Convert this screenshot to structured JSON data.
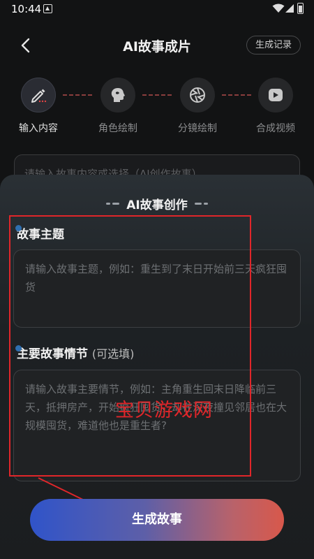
{
  "status_bar": {
    "time": "10:44"
  },
  "header": {
    "title": "AI故事成片",
    "history_label": "生成记录"
  },
  "steps": [
    {
      "label": "输入内容"
    },
    {
      "label": "角色绘制"
    },
    {
      "label": "分镜绘制"
    },
    {
      "label": "合成视频"
    }
  ],
  "background_input": {
    "placeholder": "请输入故事内容或选择（AI创作故事）"
  },
  "sheet": {
    "title": "AI故事创作",
    "theme": {
      "label": "故事主题",
      "placeholder": "请输入故事主题，例如：重生到了末日开始前三天疯狂囤货"
    },
    "plot": {
      "label": "主要故事情节",
      "optional": "(可选填)",
      "placeholder": "请输入故事主要情节，例如：主角重生回末日降临前三天，抵押房产，开始疯狂囤货，却在深夜撞见邻居也在大规模囤货，难道他也是重生者?"
    }
  },
  "annotation": {
    "watermark": "宝贝游戏网"
  },
  "generate_label": "生成故事",
  "colors": {
    "accent_red": "#e0262a",
    "cta_start": "#3054c9",
    "cta_end": "#d8584b"
  }
}
